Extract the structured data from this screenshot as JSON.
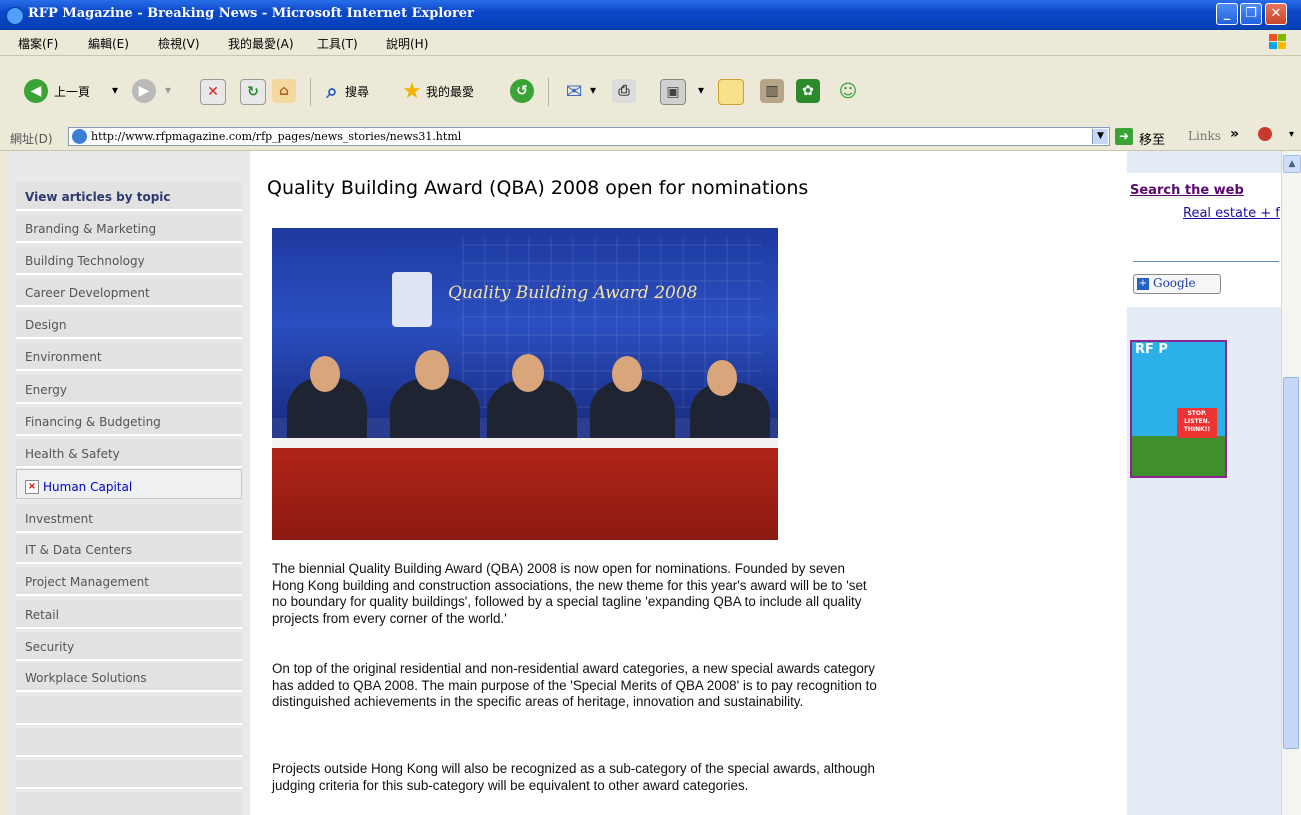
{
  "window": {
    "title": "RFP Magazine - Breaking News - Microsoft Internet Explorer"
  },
  "menubar": [
    "檔案(F)",
    "編輯(E)",
    "檢視(V)",
    "我的最愛(A)",
    "工具(T)",
    "說明(H)"
  ],
  "toolbar": {
    "back_label": "上一頁",
    "search_label": "搜尋",
    "favorites_label": "我的最愛"
  },
  "addressbar": {
    "label": "網址(D)",
    "url": "http://www.rfpmagazine.com/rfp_pages/news_stories/news31.html",
    "go_label": "移至",
    "links_label": "Links"
  },
  "sidebar": {
    "header": "View articles by topic",
    "items": [
      "Branding & Marketing",
      "Building Technology",
      "Career Development",
      "Design",
      "Environment",
      "Energy",
      "Financing & Budgeting",
      "Health & Safety",
      "Human Capital",
      "Investment",
      "IT & Data Centers",
      "Project Management",
      "Retail",
      "Security",
      "Workplace Solutions"
    ]
  },
  "article": {
    "title": "Quality Building Award (QBA) 2008 open for nominations",
    "photo_banner": "Quality Building Award 2008",
    "paragraphs": [
      "The biennial Quality Building Award (QBA) 2008 is now open for nominations. Founded by seven Hong Kong building and construction associations, the new theme for this year's award will be to 'set no boundary for quality buildings', followed by a special tagline 'expanding QBA to include all quality projects from every corner of the world.'",
      "On top of the original residential and non-residential award categories, a new special awards category has added to QBA 2008. The main purpose of the 'Special Merits of QBA 2008' is to pay recognition to distinguished achievements in the specific areas of heritage, innovation and sustainability.",
      "Projects outside Hong Kong will also be recognized as a sub-category of the special awards, although judging criteria for this sub-category will be equivalent to other award categories."
    ]
  },
  "rightbar": {
    "search_title": "Search the web",
    "search_link": "Real estate + f",
    "google_label": "Google",
    "magazine_logo": "RF P",
    "magazine_sign": "STOP. LISTEN. THINK!!"
  }
}
